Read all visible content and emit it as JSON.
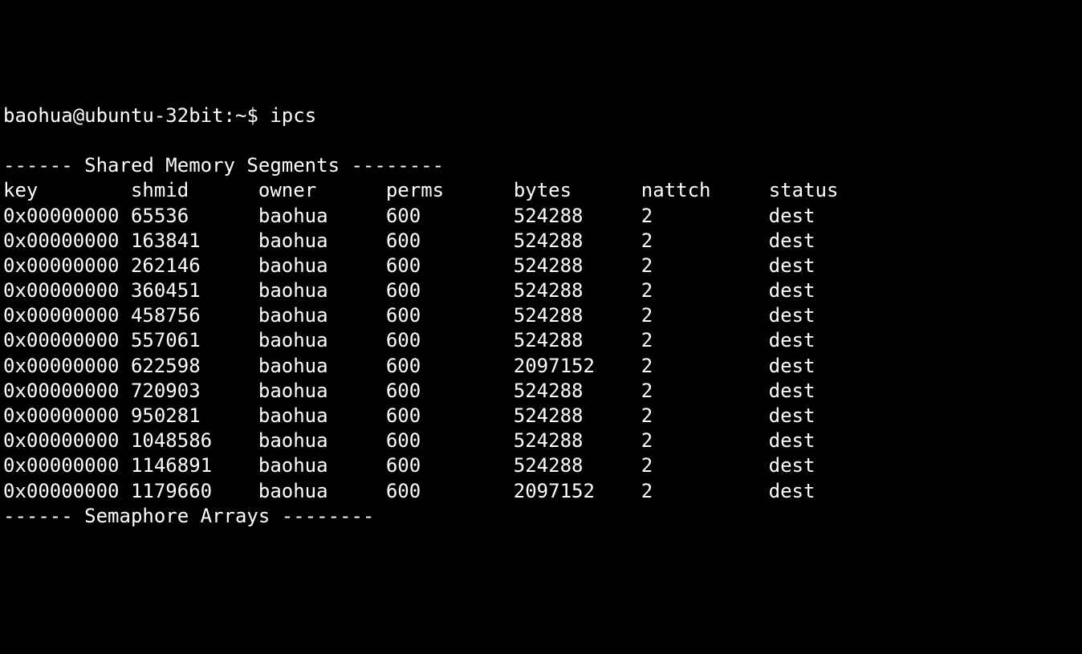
{
  "prompt": {
    "user_host": "baohua@ubuntu-32bit",
    "separator": ":",
    "path": "~",
    "symbol": "$",
    "command": "ipcs"
  },
  "shm_section": {
    "title": "------ Shared Memory Segments --------",
    "headers": {
      "key": "key",
      "shmid": "shmid",
      "owner": "owner",
      "perms": "perms",
      "bytes": "bytes",
      "nattch": "nattch",
      "status": "status"
    },
    "rows": [
      {
        "key": "0x00000000",
        "shmid": "65536",
        "owner": "baohua",
        "perms": "600",
        "bytes": "524288",
        "nattch": "2",
        "status": "dest"
      },
      {
        "key": "0x00000000",
        "shmid": "163841",
        "owner": "baohua",
        "perms": "600",
        "bytes": "524288",
        "nattch": "2",
        "status": "dest"
      },
      {
        "key": "0x00000000",
        "shmid": "262146",
        "owner": "baohua",
        "perms": "600",
        "bytes": "524288",
        "nattch": "2",
        "status": "dest"
      },
      {
        "key": "0x00000000",
        "shmid": "360451",
        "owner": "baohua",
        "perms": "600",
        "bytes": "524288",
        "nattch": "2",
        "status": "dest"
      },
      {
        "key": "0x00000000",
        "shmid": "458756",
        "owner": "baohua",
        "perms": "600",
        "bytes": "524288",
        "nattch": "2",
        "status": "dest"
      },
      {
        "key": "0x00000000",
        "shmid": "557061",
        "owner": "baohua",
        "perms": "600",
        "bytes": "524288",
        "nattch": "2",
        "status": "dest"
      },
      {
        "key": "0x00000000",
        "shmid": "622598",
        "owner": "baohua",
        "perms": "600",
        "bytes": "2097152",
        "nattch": "2",
        "status": "dest"
      },
      {
        "key": "0x00000000",
        "shmid": "720903",
        "owner": "baohua",
        "perms": "600",
        "bytes": "524288",
        "nattch": "2",
        "status": "dest"
      },
      {
        "key": "0x00000000",
        "shmid": "950281",
        "owner": "baohua",
        "perms": "600",
        "bytes": "524288",
        "nattch": "2",
        "status": "dest"
      },
      {
        "key": "0x00000000",
        "shmid": "1048586",
        "owner": "baohua",
        "perms": "600",
        "bytes": "524288",
        "nattch": "2",
        "status": "dest"
      },
      {
        "key": "0x00000000",
        "shmid": "1146891",
        "owner": "baohua",
        "perms": "600",
        "bytes": "524288",
        "nattch": "2",
        "status": "dest"
      },
      {
        "key": "0x00000000",
        "shmid": "1179660",
        "owner": "baohua",
        "perms": "600",
        "bytes": "2097152",
        "nattch": "2",
        "status": "dest"
      }
    ]
  },
  "sem_section": {
    "title": "------ Semaphore Arrays --------"
  }
}
